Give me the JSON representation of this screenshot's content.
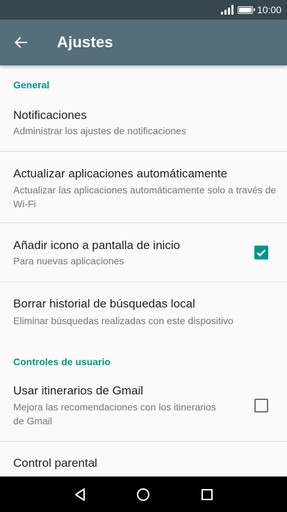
{
  "statusbar": {
    "time": "10:00"
  },
  "appbar": {
    "title": "Ajustes"
  },
  "sections": {
    "general": {
      "label": "General"
    },
    "controles": {
      "label": "Controles de usuario"
    }
  },
  "items": {
    "notificaciones": {
      "title": "Notificaciones",
      "summary": "Administrar los ajustes de notificaciones"
    },
    "actualizar": {
      "title": "Actualizar aplicaciones automáticamente",
      "summary": "Actualizar las aplicaciones automáticamente solo a través de Wi-Fi"
    },
    "anadir_icono": {
      "title": "Añadir icono a pantalla de inicio",
      "summary": "Para nuevas aplicaciones",
      "checked": true
    },
    "borrar_historial": {
      "title": "Borrar historial de búsquedas  local",
      "summary": "Eliminar búsquedas realizadas con este dispositivo"
    },
    "itinerarios": {
      "title": "Usar itinerarios de Gmail",
      "summary": "Mejora las recomendaciones con los itinerarios de Gmail",
      "checked": false
    },
    "control_parental": {
      "title": "Control parental"
    }
  },
  "colors": {
    "statusbar": "#37474f",
    "appbar": "#546e7a",
    "accent": "#009688"
  },
  "icons": {
    "back": "arrow-back-icon",
    "nav_back": "triangle-back-icon",
    "nav_home": "circle-home-icon",
    "nav_recents": "square-recents-icon"
  }
}
